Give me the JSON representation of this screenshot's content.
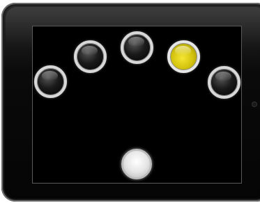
{
  "lights": [
    {
      "name": "light-1",
      "state": "off"
    },
    {
      "name": "light-2",
      "state": "off"
    },
    {
      "name": "light-3",
      "state": "off"
    },
    {
      "name": "light-4",
      "state": "on",
      "color": "#e6d51a"
    },
    {
      "name": "light-5",
      "state": "off"
    }
  ],
  "colors": {
    "lit": "#e6d51a",
    "unlit": "#111111",
    "ring": "#d8d8d8",
    "screen": "#000000"
  },
  "icons": {
    "home_button": "home-button-icon",
    "camera": "camera-icon"
  }
}
